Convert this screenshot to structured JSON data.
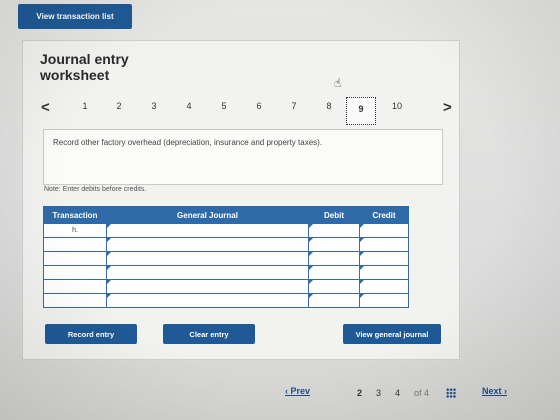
{
  "header": {
    "view_transactions_label": "View transaction list"
  },
  "panel": {
    "title": "Journal entry worksheet",
    "pager": {
      "prev_symbol": "<",
      "next_symbol": ">",
      "pages": [
        "1",
        "2",
        "3",
        "4",
        "5",
        "6",
        "7",
        "8",
        "9",
        "10"
      ],
      "active_page": "9"
    },
    "prompt": "Record other factory overhead (depreciation, insurance and property taxes).",
    "note": "Note: Enter debits before credits."
  },
  "journal": {
    "columns": [
      "Transaction",
      "General Journal",
      "Debit",
      "Credit"
    ],
    "rows": [
      [
        "h.",
        "",
        "",
        ""
      ],
      [
        "",
        "",
        "",
        ""
      ],
      [
        "",
        "",
        "",
        ""
      ],
      [
        "",
        "",
        "",
        ""
      ],
      [
        "",
        "",
        "",
        ""
      ],
      [
        "",
        "",
        "",
        ""
      ]
    ]
  },
  "actions": {
    "record": "Record entry",
    "clear": "Clear entry",
    "view_general": "View general journal"
  },
  "bottom_nav": {
    "prev": "Prev",
    "pages": [
      "2",
      "3",
      "4"
    ],
    "of_text": "of 4",
    "next": "Next"
  }
}
